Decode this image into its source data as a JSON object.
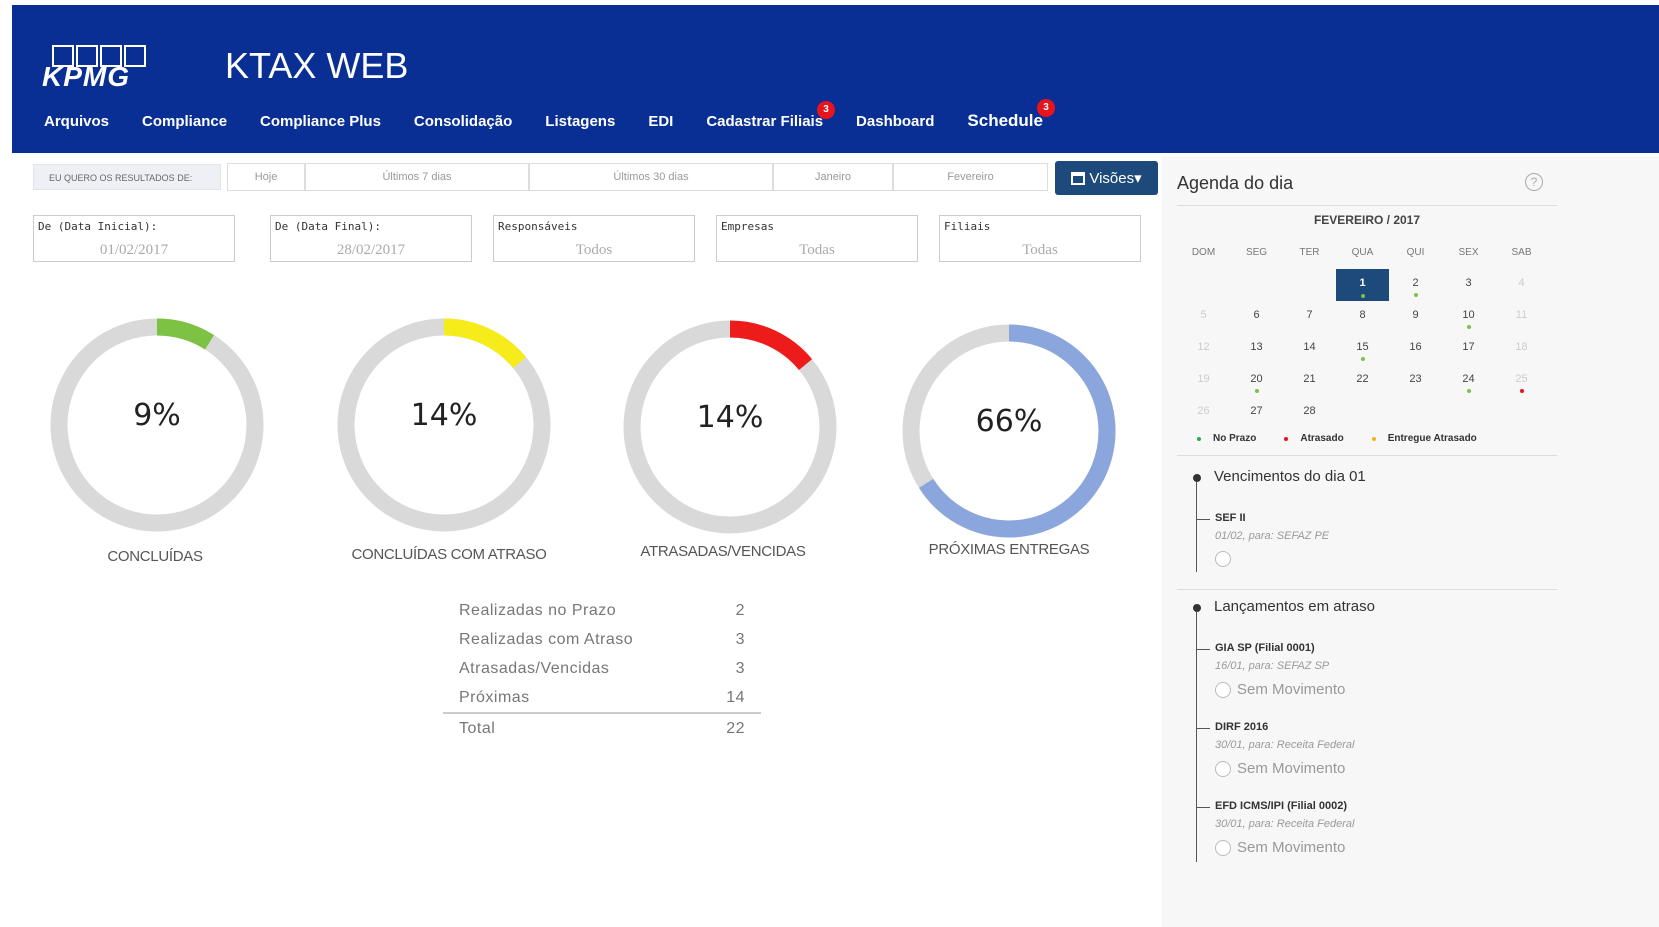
{
  "header": {
    "logo_text": "KPMG",
    "title": "KTAX WEB",
    "nav": [
      {
        "label": "Arquivos"
      },
      {
        "label": "Compliance"
      },
      {
        "label": "Compliance Plus"
      },
      {
        "label": "Consolidação"
      },
      {
        "label": "Listagens"
      },
      {
        "label": "EDI"
      },
      {
        "label": "Cadastrar Filiais",
        "badge": "3"
      },
      {
        "label": "Dashboard"
      },
      {
        "label": "Schedule",
        "badge": "3"
      }
    ]
  },
  "filters": {
    "label": "EU QUERO OS RESULTADOS DE:",
    "periods": [
      "Hoje",
      "Últimos 7 dias",
      "Últimos 30 dias",
      "Janeiro",
      "Fevereiro"
    ],
    "visoes_label": "Visões▾",
    "fields": [
      {
        "label": "De (Data Inicial):",
        "value": "01/02/2017"
      },
      {
        "label": "De (Data Final):",
        "value": "28/02/2017"
      },
      {
        "label": "Responsáveis",
        "value": "Todos"
      },
      {
        "label": "Empresas",
        "value": "Todas"
      },
      {
        "label": "Filiais",
        "value": "Todas"
      }
    ]
  },
  "donuts": [
    {
      "percent": 9,
      "text": "9%",
      "label": "CONCLUÍDAS",
      "color": "#7dc242"
    },
    {
      "percent": 14,
      "text": "14%",
      "label": "CONCLUÍDAS COM ATRASO",
      "color": "#f5ec1a"
    },
    {
      "percent": 14,
      "text": "14%",
      "label": "ATRASADAS/VENCIDAS",
      "color": "#ee1b1b"
    },
    {
      "percent": 66,
      "text": "66%",
      "label": "PRÓXIMAS ENTREGAS",
      "color": "#8aa6dc"
    }
  ],
  "summary": [
    {
      "label": "Realizadas no Prazo",
      "value": "2"
    },
    {
      "label": "Realizadas com Atraso",
      "value": "3"
    },
    {
      "label": "Atrasadas/Vencidas",
      "value": "3"
    },
    {
      "label": "Próximas",
      "value": "14"
    }
  ],
  "summary_total": {
    "label": "Total",
    "value": "22"
  },
  "agenda": {
    "title": "Agenda do dia",
    "help": "?",
    "month": "FEVEREIRO / 2017",
    "weekdays": [
      "DOM",
      "SEG",
      "TER",
      "QUA",
      "QUI",
      "SEX",
      "SAB"
    ],
    "weeks": [
      [
        {
          "d": ""
        },
        {
          "d": ""
        },
        {
          "d": ""
        },
        {
          "d": "1",
          "sel": true,
          "dot": "#7dc242"
        },
        {
          "d": "2",
          "dot": "#7dc242"
        },
        {
          "d": "3"
        },
        {
          "d": "4",
          "muted": true
        }
      ],
      [
        {
          "d": "5",
          "muted": true
        },
        {
          "d": "6"
        },
        {
          "d": "7"
        },
        {
          "d": "8"
        },
        {
          "d": "9"
        },
        {
          "d": "10",
          "dot": "#7dc242"
        },
        {
          "d": "11",
          "muted": true
        }
      ],
      [
        {
          "d": "12",
          "muted": true
        },
        {
          "d": "13"
        },
        {
          "d": "14"
        },
        {
          "d": "15",
          "dot": "#7dc242"
        },
        {
          "d": "16"
        },
        {
          "d": "17"
        },
        {
          "d": "18",
          "muted": true
        }
      ],
      [
        {
          "d": "19",
          "muted": true
        },
        {
          "d": "20",
          "dot": "#7dc242"
        },
        {
          "d": "21"
        },
        {
          "d": "22"
        },
        {
          "d": "23"
        },
        {
          "d": "24",
          "dot": "#7dc242"
        },
        {
          "d": "25",
          "muted": true,
          "dot": "#e8141d"
        }
      ],
      [
        {
          "d": "26",
          "muted": true
        },
        {
          "d": "27"
        },
        {
          "d": "28"
        },
        {
          "d": ""
        },
        {
          "d": ""
        },
        {
          "d": ""
        },
        {
          "d": ""
        }
      ]
    ],
    "legend": [
      {
        "label": "No Prazo",
        "color": "#2fa84f"
      },
      {
        "label": "Atrasado",
        "color": "#e8141d"
      },
      {
        "label": "Entregue Atrasado",
        "color": "#f5b21a"
      }
    ],
    "vencimentos_title": "Vencimentos do dia 01",
    "vencimentos": [
      {
        "name": "SEF II",
        "sub": "01/02, para: SEFAZ PE",
        "radio": ""
      }
    ],
    "atraso_title": "Lançamentos em atraso",
    "atrasos": [
      {
        "name": "GIA SP (Filial 0001)",
        "sub": "16/01, para: SEFAZ SP",
        "radio": "Sem Movimento"
      },
      {
        "name": "DIRF 2016",
        "sub": "30/01, para: Receita Federal",
        "radio": "Sem Movimento"
      },
      {
        "name": "EFD ICMS/IPI (Filial 0002)",
        "sub": "30/01, para: Receita Federal",
        "radio": "Sem Movimento"
      }
    ]
  }
}
